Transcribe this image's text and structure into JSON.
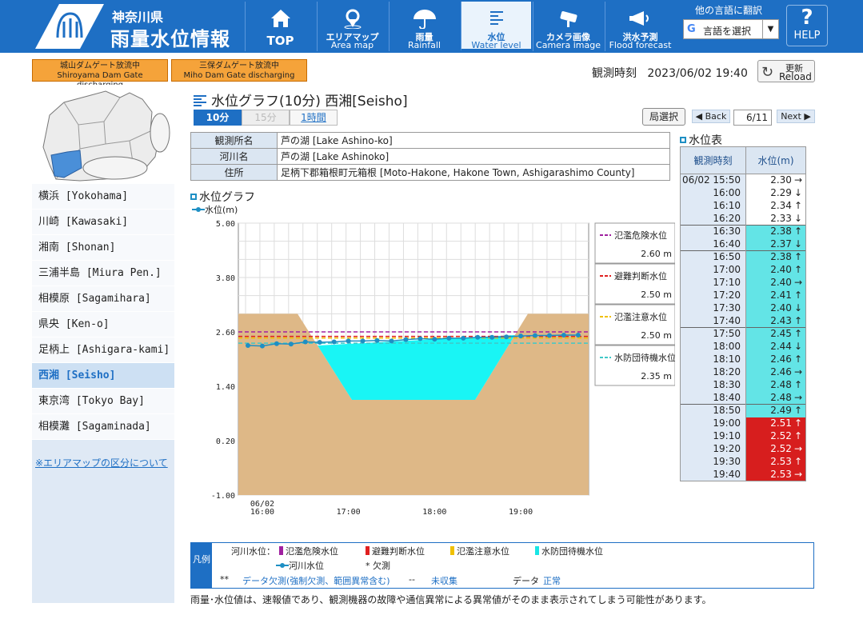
{
  "header": {
    "prefecture": "神奈川県",
    "app_title": "雨量水位情報",
    "nav": [
      {
        "l1": "TOP",
        "l2": ""
      },
      {
        "l1": "エリアマップ",
        "l2": "Area map"
      },
      {
        "l1": "雨量",
        "l2": "Rainfall"
      },
      {
        "l1": "水位",
        "l2": "Water level"
      },
      {
        "l1": "カメラ画像",
        "l2": "Camera image"
      },
      {
        "l1": "洪水予測",
        "l2": "Flood forecast"
      }
    ],
    "lang_label": "他の言語に翻訳",
    "lang_select": "言語を選択",
    "help": "HELP"
  },
  "dam_notices": [
    {
      "jp": "城山ダムゲート放流中",
      "en": "Shiroyama Dam Gate discharging"
    },
    {
      "jp": "三保ダムゲート放流中",
      "en": "Miho Dam Gate discharging"
    }
  ],
  "observation": {
    "label": "観測時刻",
    "time": "2023/06/02 19:40"
  },
  "reload": {
    "jp": "更新",
    "en": "Reload"
  },
  "sidebar": {
    "items": [
      "横浜 [Yokohama]",
      "川崎 [Kawasaki]",
      "湘南 [Shonan]",
      "三浦半島 [Miura Pen.]",
      "相模原 [Sagamihara]",
      "県央 [Ken-o]",
      "足柄上 [Ashigara-kami]",
      "西湘 [Seisho]",
      "東京湾 [Tokyo Bay]",
      "相模灘 [Sagaminada]"
    ],
    "active_index": 7,
    "link": "※エリアマップの区分について"
  },
  "page_title": "水位グラフ(10分) 西湘[Seisho]",
  "intervals": [
    "10分",
    "15分",
    "1時間"
  ],
  "pref_select": "局選択",
  "back": "Back",
  "next": "Next",
  "pager": "6/11",
  "station": [
    {
      "k": "観測所名",
      "v": "芦の湖 [Lake Ashino-ko]"
    },
    {
      "k": "河川名",
      "v": "芦の湖 [Lake Ashinoko]"
    },
    {
      "k": "住所",
      "v": "足柄下郡箱根町元箱根 [Moto-Hakone, Hakone Town, Ashigarashimo County]"
    }
  ],
  "graph_title": "水位グラフ",
  "graph_legend": "水位(m)",
  "table_title": "水位表",
  "table_headers": [
    "観測時刻",
    "水位(m)"
  ],
  "table_rows": [
    {
      "t": "06/02 15:50",
      "v": "2.30",
      "a": "→",
      "c": "#ffffff"
    },
    {
      "t": "16:00",
      "v": "2.29",
      "a": "↓",
      "c": "#ffffff"
    },
    {
      "t": "16:10",
      "v": "2.34",
      "a": "↑",
      "c": "#ffffff"
    },
    {
      "t": "16:20",
      "v": "2.33",
      "a": "↓",
      "c": "#ffffff"
    },
    {
      "t": "16:30",
      "v": "2.38",
      "a": "↑",
      "c": "#63e4e6"
    },
    {
      "t": "16:40",
      "v": "2.37",
      "a": "↓",
      "c": "#63e4e6"
    },
    {
      "t": "16:50",
      "v": "2.38",
      "a": "↑",
      "c": "#63e4e6"
    },
    {
      "t": "17:00",
      "v": "2.40",
      "a": "↑",
      "c": "#63e4e6"
    },
    {
      "t": "17:10",
      "v": "2.40",
      "a": "→",
      "c": "#63e4e6"
    },
    {
      "t": "17:20",
      "v": "2.41",
      "a": "↑",
      "c": "#63e4e6"
    },
    {
      "t": "17:30",
      "v": "2.40",
      "a": "↓",
      "c": "#63e4e6"
    },
    {
      "t": "17:40",
      "v": "2.43",
      "a": "↑",
      "c": "#63e4e6"
    },
    {
      "t": "17:50",
      "v": "2.45",
      "a": "↑",
      "c": "#63e4e6"
    },
    {
      "t": "18:00",
      "v": "2.44",
      "a": "↓",
      "c": "#63e4e6"
    },
    {
      "t": "18:10",
      "v": "2.46",
      "a": "↑",
      "c": "#63e4e6"
    },
    {
      "t": "18:20",
      "v": "2.46",
      "a": "→",
      "c": "#63e4e6"
    },
    {
      "t": "18:30",
      "v": "2.48",
      "a": "↑",
      "c": "#63e4e6"
    },
    {
      "t": "18:40",
      "v": "2.48",
      "a": "→",
      "c": "#63e4e6"
    },
    {
      "t": "18:50",
      "v": "2.49",
      "a": "↑",
      "c": "#63e4e6"
    },
    {
      "t": "19:00",
      "v": "2.51",
      "a": "↑",
      "c": "#d71e1e"
    },
    {
      "t": "19:10",
      "v": "2.52",
      "a": "↑",
      "c": "#d71e1e"
    },
    {
      "t": "19:20",
      "v": "2.52",
      "a": "→",
      "c": "#d71e1e"
    },
    {
      "t": "19:30",
      "v": "2.53",
      "a": "↑",
      "c": "#d71e1e"
    },
    {
      "t": "19:40",
      "v": "2.53",
      "a": "→",
      "c": "#d71e1e"
    }
  ],
  "chart_data": {
    "type": "line",
    "x": [
      "15:50",
      "16:00",
      "16:10",
      "16:20",
      "16:30",
      "16:40",
      "16:50",
      "17:00",
      "17:10",
      "17:20",
      "17:30",
      "17:40",
      "17:50",
      "18:00",
      "18:10",
      "18:20",
      "18:30",
      "18:40",
      "18:50",
      "19:00",
      "19:10",
      "19:20",
      "19:30",
      "19:40"
    ],
    "x_tick_labels": [
      {
        "at": "16:00",
        "label": "06/02\n16:00"
      },
      {
        "at": "17:00",
        "label": "17:00"
      },
      {
        "at": "18:00",
        "label": "18:00"
      },
      {
        "at": "19:00",
        "label": "19:00"
      }
    ],
    "series": [
      {
        "name": "水位(m)",
        "values": [
          2.3,
          2.29,
          2.34,
          2.33,
          2.38,
          2.37,
          2.38,
          2.4,
          2.4,
          2.41,
          2.4,
          2.43,
          2.45,
          2.44,
          2.46,
          2.46,
          2.48,
          2.48,
          2.49,
          2.51,
          2.52,
          2.52,
          2.53,
          2.53
        ],
        "color": "#1e8fc4"
      }
    ],
    "y_ticks": [
      "5.00",
      "3.80",
      "2.60",
      "1.40",
      "0.20",
      "-1.00"
    ],
    "ylim": [
      -1.0,
      5.0
    ],
    "grid": true,
    "thresholds": [
      {
        "name": "氾濫危険水位",
        "value": 2.6,
        "label": "2.60 m",
        "color": "#a020a0"
      },
      {
        "name": "避難判断水位",
        "value": 2.5,
        "label": "2.50 m",
        "color": "#e02020"
      },
      {
        "name": "氾濫注意水位",
        "value": 2.5,
        "label": "2.50 m",
        "color": "#f0c000"
      },
      {
        "name": "水防団待機水位",
        "value": 2.35,
        "label": "2.35 m",
        "color": "#40c8c8"
      }
    ],
    "bank_height": 3.0,
    "bed_level": 1.1,
    "colors": {
      "bank": "#deb887",
      "water": "#19f5f5"
    }
  },
  "legend": {
    "head": "凡例",
    "river_label": "河川水位：",
    "items": [
      {
        "name": "氾濫危険水位",
        "color": "#a020a0"
      },
      {
        "name": "避難判断水位",
        "color": "#e02020"
      },
      {
        "name": "氾濫注意水位",
        "color": "#f0c000"
      },
      {
        "name": "水防団待機水位",
        "color": "#19e5e5"
      }
    ],
    "river_level": "河川水位",
    "missing": "* 欠測",
    "row3": [
      {
        "k": "**",
        "v": "データ欠測(強制欠測、範囲異常含む)"
      },
      {
        "k": "--",
        "v": "未収集"
      },
      {
        "k": "データ",
        "v": "正常"
      }
    ]
  },
  "footer": "雨量･水位値は、速報値であり、観測機器の故障や通信異常による異常値がそのまま表示されてしまう可能性があります。"
}
